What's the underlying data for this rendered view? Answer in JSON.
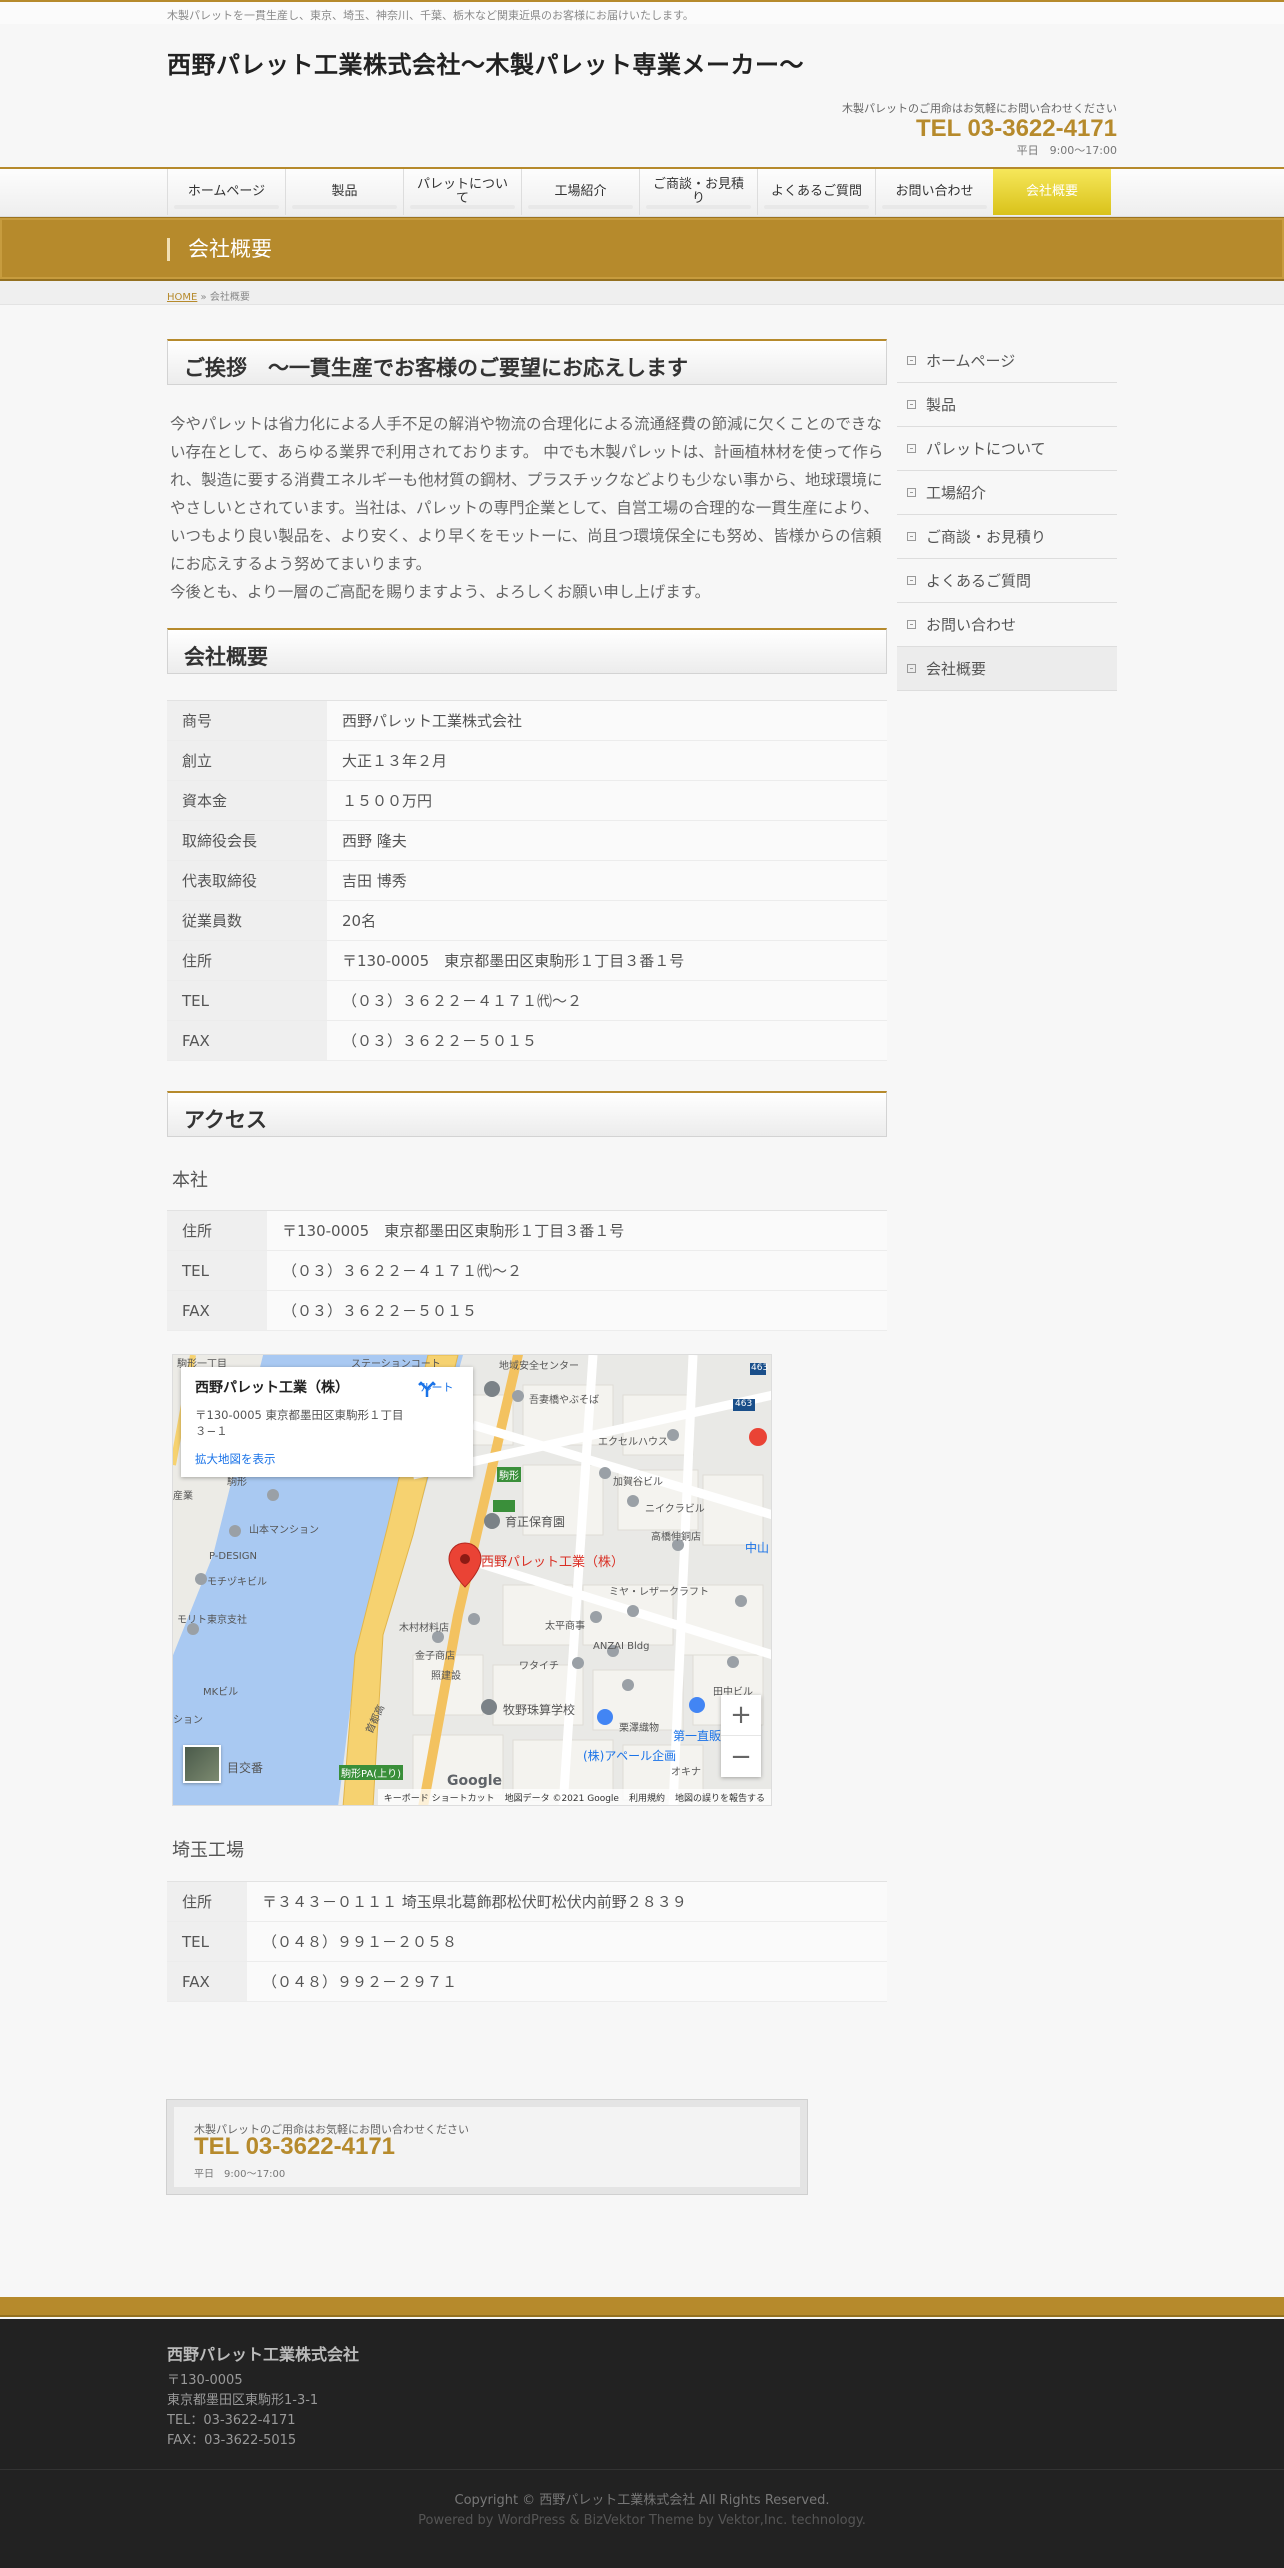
{
  "header": {
    "tagline": "木製パレットを一貫生産し、東京、埼玉、神奈川、千葉、栃木など関東近県のお客様にお届けいたします。",
    "site_title": "西野パレット工業株式会社～木製パレット専業メーカー～",
    "contact_lead": "木製パレットのご用命はお気軽にお問い合わせください",
    "tel": "TEL 03-3622-4171",
    "hours": "平日　9:00～17:00"
  },
  "nav": {
    "items": [
      "ホームページ",
      "製品",
      "パレットについて",
      "工場紹介",
      "ご商談・お見積り",
      "よくあるご質問",
      "お問い合わせ",
      "会社概要"
    ],
    "active": "会社概要"
  },
  "page": {
    "title": "会社概要",
    "breadcrumb_home": "HOME",
    "breadcrumb_sep": "»",
    "breadcrumb_current": "会社概要"
  },
  "greeting": {
    "heading": "ご挨拶　～一貫生産でお客様のご要望にお応えします",
    "body": "今やパレットは省力化による人手不足の解消や物流の合理化による流通経費の節減に欠くことのできない存在として、あらゆる業界で利用されております。 中でも木製パレットは、計画植林材を使って作られ、製造に要する消費エネルギーも他材質の鋼材、プラスチックなどよりも少ない事から、地球環境にやさしいとされています。当社は、パレットの専門企業として、自営工場の合理的な一貫生産により、いつもより良い製品を、より安く、より早くをモットーに、尚且つ環境保全にも努め、皆様からの信頼にお応えするよう努めてまいります。",
    "closing": "今後とも、より一層のご高配を賜りますよう、よろしくお願い申し上げます。"
  },
  "overview": {
    "heading": "会社概要",
    "rows": [
      {
        "label": "商号",
        "value": "西野パレット工業株式会社"
      },
      {
        "label": "創立",
        "value": "大正１３年２月"
      },
      {
        "label": "資本金",
        "value": "１５００万円"
      },
      {
        "label": "取締役会長",
        "value": "西野 隆夫"
      },
      {
        "label": "代表取締役",
        "value": "吉田 博秀"
      },
      {
        "label": "従業員数",
        "value": "20名"
      },
      {
        "label": "住所",
        "value": "〒130-0005　東京都墨田区東駒形１丁目３番１号"
      },
      {
        "label": "TEL",
        "value": "（０３）３６２２－４１７１㈹～２"
      },
      {
        "label": "FAX",
        "value": "（０３）３６２２－５０１５"
      }
    ]
  },
  "access": {
    "heading": "アクセス",
    "head_office": {
      "title": "本社",
      "rows": [
        {
          "label": "住所",
          "value": "〒130-0005　東京都墨田区東駒形１丁目３番１号"
        },
        {
          "label": "TEL",
          "value": "（０３）３６２２－４１７１㈹～２"
        },
        {
          "label": "FAX",
          "value": "（０３）３６２２－５０１５"
        }
      ]
    },
    "factory": {
      "title": "埼玉工場",
      "rows": [
        {
          "label": "住所",
          "value": "〒３４３－０１１１ 埼玉県北葛飾郡松伏町松伏内前野２８３９"
        },
        {
          "label": "TEL",
          "value": "（０４８）９９１－２０５８"
        },
        {
          "label": "FAX",
          "value": "（０４８）９９２－２９７１"
        }
      ]
    }
  },
  "map": {
    "place_name": "西野パレット工業（株）",
    "place_address": "〒130-0005 東京都墨田区東駒形１丁目３−１",
    "enlarge_link": "拡大地図を表示",
    "route_label": "ルート",
    "pin_label": "西野パレット工業（株）",
    "labels": {
      "l1": "地域安全センター",
      "l2": "吾妻橋やぶそば",
      "l3": "エクセルハウス",
      "l4": "加賀谷ビル",
      "l5": "ニイクラビル",
      "l6": "高橋伸銅店",
      "l7": "育正保育園",
      "l8": "中山",
      "l9": "ミヤ・レザークラフト",
      "l10": "太平商事",
      "l11": "ANZAI Bldg",
      "l12": "木村材料店",
      "l13": "金子商店",
      "l14": "照建設",
      "l15": "ワタイチ",
      "l16": "牧野珠算学校",
      "l17": "栗澤織物",
      "l18": "第一直販",
      "l19": "(株)アペール企画",
      "l20": "田中ビル",
      "l21": "オキナ",
      "l22": "山本マンション",
      "l23": "P-DESIGN",
      "l24": "モチヅキビル",
      "l25": "モリト東京支社",
      "l26": "MKビル",
      "l27": "目交番",
      "l28": "駒形",
      "l29": "駒形PA(上り)",
      "l30": "首都高",
      "l31": "駒形",
      "l32": "駒形一丁目",
      "l33": "ステーションコート",
      "l34": "産業",
      "l35": "ション",
      "l36": "463",
      "l37": "463"
    },
    "google": "Google",
    "attribution": [
      "キーボード ショートカット",
      "地図データ ©2021 Google",
      "利用規約",
      "地図の誤りを報告する"
    ]
  },
  "cta": {
    "lead": "木製パレットのご用命はお気軽にお問い合わせください",
    "tel": "TEL 03-3622-4171",
    "hours": "平日　9:00～17:00"
  },
  "sidebar": {
    "items": [
      "ホームページ",
      "製品",
      "パレットについて",
      "工場紹介",
      "ご商談・お見積り",
      "よくあるご質問",
      "お問い合わせ",
      "会社概要"
    ],
    "current": "会社概要"
  },
  "footer": {
    "company": "西野パレット工業株式会社",
    "postal": "〒130-0005",
    "address": "東京都墨田区東駒形1-3-1",
    "tel": "TEL：03-3622-4171",
    "fax": "FAX：03-3622-5015",
    "copyright": "Copyright © 西野パレット工業株式会社 All Rights Reserved.",
    "powered": "Powered by WordPress & BizVektor Theme by Vektor,Inc. technology."
  },
  "colors": {
    "accent": "#b68a2c",
    "active_nav": "#e8d42a",
    "footer_bg": "#222222"
  }
}
